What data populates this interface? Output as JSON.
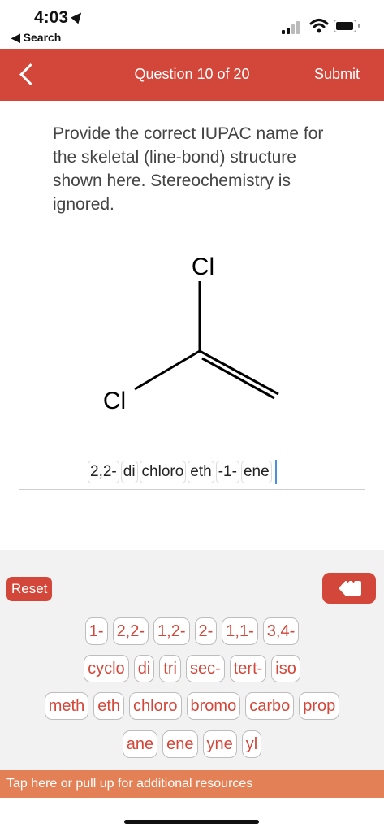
{
  "status_bar": {
    "time": "4:03",
    "back_label": "◀ Search"
  },
  "header": {
    "title": "Question 10 of 20",
    "submit_label": "Submit"
  },
  "prompt": "Provide the correct IUPAC name for the skeletal (line-bond) structure shown here. Stereochemistry is ignored.",
  "molecule": {
    "atom_label_top": "Cl",
    "atom_label_left": "Cl"
  },
  "answer_chips": [
    "2,2-",
    "di",
    "chloro",
    "eth",
    "-1-",
    "ene"
  ],
  "keyboard": {
    "reset_label": "Reset",
    "backspace_glyph": "✕",
    "rows": [
      [
        "1-",
        "2,2-",
        "1,2-",
        "2-",
        "1,1-",
        "3,4-"
      ],
      [
        "cyclo",
        "di",
        "tri",
        "sec-",
        "tert-",
        "iso"
      ],
      [
        "meth",
        "eth",
        "chloro",
        "bromo",
        "carbo",
        "prop"
      ],
      [
        "ane",
        "ene",
        "yne",
        "yl"
      ]
    ]
  },
  "resources_label": "Tap here or pull up for additional resources",
  "colors": {
    "accent": "#d3473a",
    "resources_bar": "#e48056",
    "keyboard_bg": "#f2f2f2"
  }
}
